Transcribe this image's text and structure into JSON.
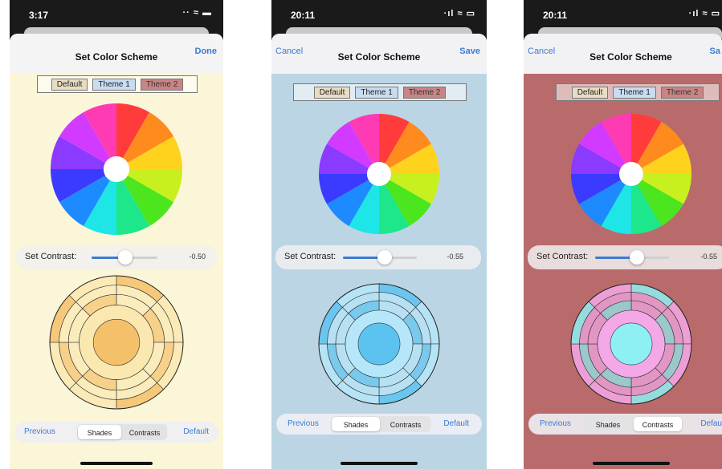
{
  "screens": [
    {
      "time": "3:17",
      "status_icons": "·· ≈ ▬",
      "cancel_label": "",
      "title": "Set Color Scheme",
      "done_label": "Done",
      "themes": [
        "Default",
        "Theme 1",
        "Theme 2"
      ],
      "contrast_label": "Set Contrast:",
      "contrast_value": "-0.50",
      "contrast_level": -0.5,
      "prev_label": "Previous",
      "segments": [
        "Shades",
        "Contrasts"
      ],
      "selected_segment": 0,
      "default_label": "Default",
      "background_color": "#fbf6d8",
      "shade_base": "#f5c06a",
      "shade_light": "#fbe8b0"
    },
    {
      "time": "20:11",
      "status_icons": "·ıl ≈ ▭",
      "cancel_label": "Cancel",
      "title": "Set Color Scheme",
      "done_label": "Save",
      "themes": [
        "Default",
        "Theme 1",
        "Theme 2"
      ],
      "contrast_label": "Set Contrast:",
      "contrast_value": "-0.55",
      "contrast_level": -0.55,
      "prev_label": "Previous",
      "segments": [
        "Shades",
        "Contrasts"
      ],
      "selected_segment": 0,
      "default_label": "Default",
      "background_color": "#bcd5e4",
      "shade_base": "#5cc3f0",
      "shade_light": "#b5e6fa"
    },
    {
      "time": "20:11",
      "status_icons": "·ıl ≈ ▭",
      "cancel_label": "Cancel",
      "title": "Set Color Scheme",
      "done_label": "Sa",
      "themes": [
        "Default",
        "Theme 1",
        "Theme 2"
      ],
      "contrast_label": "Set Contrast:",
      "contrast_value": "-0.55",
      "contrast_level": -0.55,
      "prev_label": "Previous",
      "segments": [
        "Shades",
        "Contrasts"
      ],
      "selected_segment": 1,
      "default_label": "Default",
      "background_color": "#b96b6b",
      "shade_base": "#8ef0f2",
      "shade_light": "#f4a8e8"
    }
  ],
  "wheel_colors": [
    "#ff3b3b",
    "#ff8a1e",
    "#ffd21e",
    "#c8f01e",
    "#4ce61e",
    "#1ee68a",
    "#1ee6e6",
    "#1e8aff",
    "#3b3bff",
    "#8a3bff",
    "#d23bff",
    "#ff3bb4"
  ]
}
